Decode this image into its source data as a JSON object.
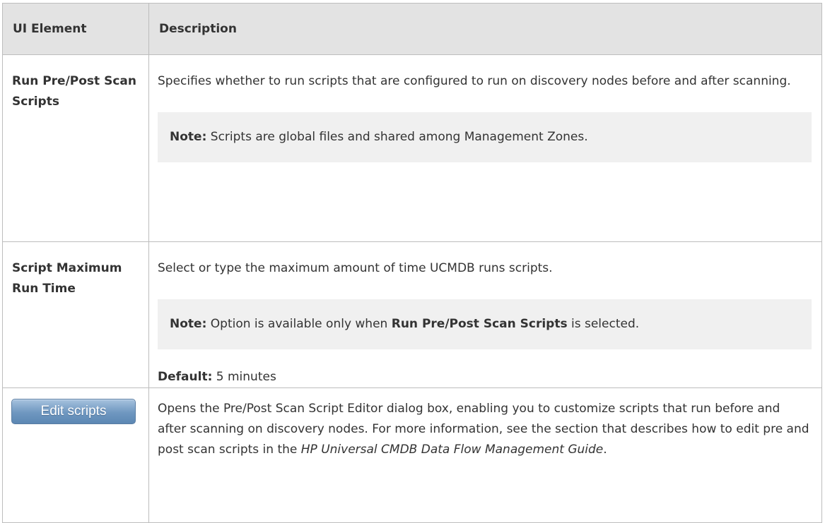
{
  "table": {
    "headers": [
      "UI Element",
      "Description"
    ],
    "rows": [
      {
        "name": "Run Pre/Post Scan Scripts",
        "description": "Specifies whether to run scripts that are configured to run on discovery nodes before and after scanning.",
        "note_label": "Note:",
        "note_text": "Scripts are global files and shared among Management Zones."
      },
      {
        "name": "Script Maximum Run Time",
        "description": "Select or type the maximum amount of time UCMDB runs scripts.",
        "note_label": "Note:",
        "note_text_before": "Option is available only when",
        "note_bold": "Run Pre/Post Scan Scripts",
        "note_text_after": "is selected.",
        "default_label": "Default:",
        "default_value": "5 minutes"
      },
      {
        "button_label": "Edit scripts",
        "description_start": "Opens the Pre/Post Scan Script Editor dialog box, enabling you to customize scripts that run before and after scanning on discovery nodes. For more information, see the section that describes how to edit pre and post scan scripts in the",
        "guide_title": "HP Universal CMDB Data Flow Management Guide",
        "description_end": "."
      }
    ]
  }
}
